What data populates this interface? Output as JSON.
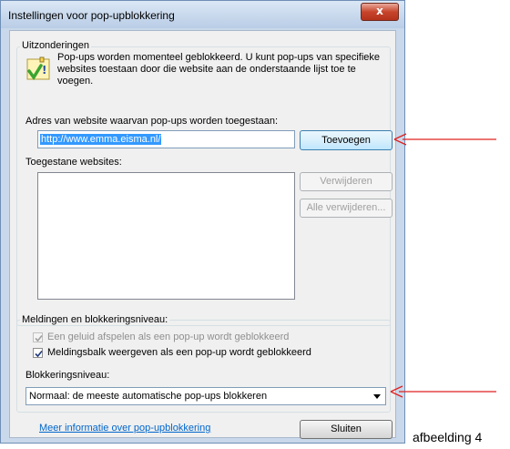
{
  "window": {
    "title": "Instellingen voor pop-upblokkering",
    "close_glyph": "x"
  },
  "exceptions": {
    "group_label": "Uitzonderingen",
    "info_text": [
      "Pop-ups worden momenteel geblokkeerd. U kunt pop-ups van specifieke",
      "websites toestaan door die website aan de onderstaande lijst toe te",
      "voegen."
    ],
    "address_label": "Adres van website waarvan pop-ups worden toegestaan:",
    "address_value": "http://www.emma.eisma.nl/",
    "add_button": "Toevoegen",
    "allowed_label": "Toegestane websites:",
    "allowed_sites": [],
    "remove_button": "Verwijderen",
    "remove_all_button": "Alle verwijderen..."
  },
  "notifications": {
    "group_label": "Meldingen en blokkeringsniveau:",
    "sound_option": {
      "label": "Een geluid afspelen als een pop-up wordt geblokkeerd",
      "checked": true,
      "enabled": false
    },
    "infobar_option": {
      "label": "Meldingsbalk weergeven als een pop-up wordt geblokkeerd",
      "checked": true,
      "enabled": true
    },
    "level_label": "Blokkeringsniveau:",
    "level_value": "Normaal: de meeste automatische pop-ups blokkeren"
  },
  "footer": {
    "more_info_link": "Meer informatie over pop-upblokkering",
    "close_button": "Sluiten"
  },
  "annotation": {
    "caption": "afbeelding 4",
    "arrow_color": "#e02020"
  },
  "colors": {
    "selection": "#3399ff",
    "link": "#0066cc"
  }
}
